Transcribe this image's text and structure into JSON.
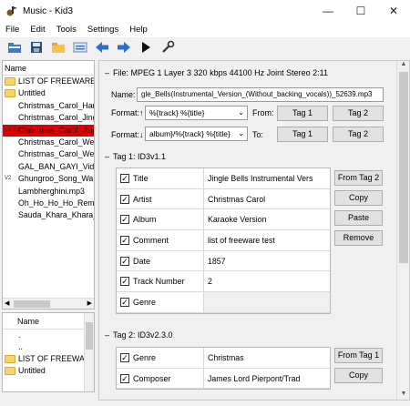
{
  "window": {
    "title": "Music - Kid3"
  },
  "menu": [
    "File",
    "Edit",
    "Tools",
    "Settings",
    "Help"
  ],
  "file_list": {
    "header": "Name",
    "items": [
      {
        "marker": "",
        "label": "LIST OF FREEWARE",
        "folder": true
      },
      {
        "marker": "",
        "label": "Untitled",
        "folder": true
      },
      {
        "marker": "",
        "label": "Christmas_Carol_Har",
        "folder": false
      },
      {
        "marker": "",
        "label": "Christmas_Carol_Jing",
        "folder": false
      },
      {
        "marker": "V1 V2",
        "label": "Christmas_Carol_Jing",
        "folder": false,
        "selected": true
      },
      {
        "marker": "",
        "label": "Christmas_Carol_We_",
        "folder": false
      },
      {
        "marker": "",
        "label": "Christmas_Carol_We_",
        "folder": false
      },
      {
        "marker": "",
        "label": "GAL_BAN_GAYI_Vide",
        "folder": false
      },
      {
        "marker": "V2",
        "label": "Ghungroo_Song_War",
        "folder": false
      },
      {
        "marker": "",
        "label": "Lambherghini.mp3",
        "folder": false
      },
      {
        "marker": "",
        "label": "Oh_Ho_Ho_Ho_Remi",
        "folder": false
      },
      {
        "marker": "",
        "label": "Sauda_Khara_Khara_C",
        "folder": false
      }
    ]
  },
  "dir_list": {
    "header": "Name",
    "items": [
      {
        "label": ".",
        "folder": false
      },
      {
        "label": "..",
        "folder": false
      },
      {
        "label": "LIST OF FREEWAR",
        "folder": true
      },
      {
        "label": "Untitled",
        "folder": true
      }
    ]
  },
  "file_section": {
    "title": "File: MPEG 1 Layer 3 320 kbps 44100 Hz Joint Stereo 2:11",
    "name_label": "Name:",
    "name_value": "gle_Bells(Instrumental_Version_(Without_backing_vocals))_52639.mp3",
    "format_up_label": "Format:↑",
    "format_up_value": "%{track} %{title}",
    "from_label": "From:",
    "format_down_label": "Format:↓",
    "format_down_value": "album}/%{track} %{title}",
    "to_label": "To:",
    "tag1_btn": "Tag 1",
    "tag2_btn": "Tag 2"
  },
  "tag1": {
    "title": "Tag 1: ID3v1.1",
    "rows": [
      {
        "name": "Title",
        "value": "Jingle Bells Instrumental Vers"
      },
      {
        "name": "Artist",
        "value": "Christmas Carol"
      },
      {
        "name": "Album",
        "value": "Karaoke Version"
      },
      {
        "name": "Comment",
        "value": "list of freeware test"
      },
      {
        "name": "Date",
        "value": "1857"
      },
      {
        "name": "Track Number",
        "value": "2"
      },
      {
        "name": "Genre",
        "value": ""
      }
    ],
    "buttons": {
      "from": "From Tag 2",
      "copy": "Copy",
      "paste": "Paste",
      "remove": "Remove"
    }
  },
  "tag2": {
    "title": "Tag 2: ID3v2.3.0",
    "rows": [
      {
        "name": "Genre",
        "value": "Christmas"
      },
      {
        "name": "Composer",
        "value": "James Lord Pierpont/Trad"
      }
    ],
    "buttons": {
      "from": "From Tag 1",
      "copy": "Copy"
    }
  }
}
